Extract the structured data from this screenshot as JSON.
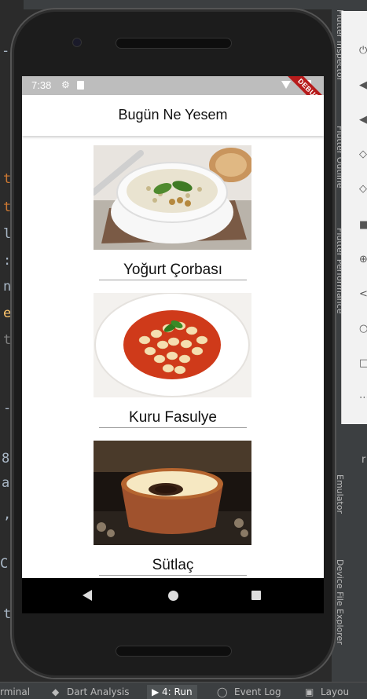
{
  "ide": {
    "bottom_tabs": [
      {
        "label": "rminal"
      },
      {
        "label": "Dart Analysis"
      },
      {
        "label": "4: Run"
      },
      {
        "label": "Event Log"
      },
      {
        "label": "Layou"
      }
    ],
    "right_labels": {
      "flutter_inspector": "Flutter Inspector",
      "flutter_outline": "Flutter Outline",
      "flutter_performance": "Flutter Performance",
      "emulator": "Emulator",
      "device_file_explorer": "Device File Explorer"
    },
    "code_chars": [
      "-.",
      "t",
      "t",
      "l",
      ":",
      "n",
      "e",
      "t",
      "-",
      "8",
      "a",
      ",",
      "C",
      "t"
    ],
    "side_char": "r"
  },
  "status_bar": {
    "time": "7:38"
  },
  "debug_banner": "DEBUG",
  "app_bar": {
    "title": "Bugün Ne Yesem"
  },
  "foods": [
    {
      "name": "Yoğurt Çorbası"
    },
    {
      "name": "Kuru Fasulye"
    },
    {
      "name": "Sütlaç"
    }
  ],
  "colors": {
    "status_bar": "#bdbdbd",
    "debug_banner": "#b71c1c",
    "nav_bar": "#000000"
  }
}
